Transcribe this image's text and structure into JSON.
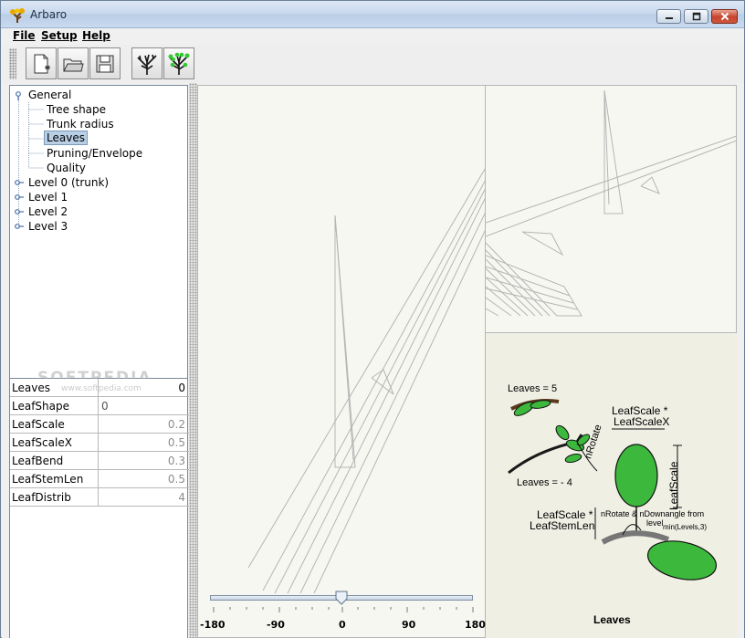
{
  "window": {
    "title": "Arbaro"
  },
  "menu": [
    {
      "label": "File"
    },
    {
      "label": "Setup"
    },
    {
      "label": "Help"
    }
  ],
  "toolbar": {
    "buttons": [
      {
        "icon": "new-file-icon"
      },
      {
        "icon": "open-folder-icon"
      },
      {
        "icon": "save-disk-icon"
      },
      {
        "icon": "tree-render-icon"
      },
      {
        "icon": "tree-leaves-render-icon"
      }
    ]
  },
  "tree": {
    "nodes": [
      {
        "label": "General"
      },
      {
        "label": "Tree shape"
      },
      {
        "label": "Trunk radius"
      },
      {
        "label": "Leaves",
        "selected": true
      },
      {
        "label": "Pruning/Envelope"
      },
      {
        "label": "Quality"
      },
      {
        "label": "Level 0 (trunk)"
      },
      {
        "label": "Level 1"
      },
      {
        "label": "Level 2"
      },
      {
        "label": "Level 3"
      }
    ]
  },
  "params": {
    "rows": [
      {
        "name": "Leaves",
        "value": "0"
      },
      {
        "name": "LeafShape",
        "value": "0"
      },
      {
        "name": "LeafScale",
        "value": "0.2"
      },
      {
        "name": "LeafScaleX",
        "value": "0.5"
      },
      {
        "name": "LeafBend",
        "value": "0.3"
      },
      {
        "name": "LeafStemLen",
        "value": "0.5"
      },
      {
        "name": "LeafDistrib",
        "value": "4"
      }
    ]
  },
  "watermark": {
    "text": "SOFTPEDIA",
    "sub": "www.softpedia.com"
  },
  "slider": {
    "ticks": [
      "-180",
      "-90",
      "0",
      "90",
      "180"
    ],
    "value": 0,
    "min": -180,
    "max": 180
  },
  "help_image": {
    "leaves_eq": "Leaves = 5",
    "leaves_neg": "Leaves = - 4",
    "nrotate": "nRotate",
    "leafscale_x_1": "LeafScale *",
    "leafscale_x_2": "LeafScaleX",
    "leafscale": "LeafScale",
    "stemlen_1": "LeafScale *",
    "stemlen_2": "LeafStemLen",
    "downangle_1": "nRotate & nDownangle from",
    "downangle_2": "level",
    "downangle_3": "min(Levels,3)",
    "caption": "Leaves"
  },
  "colors": {
    "leaf_green": "#3cb83c",
    "selection": "#b8cfe5",
    "view_bg": "#f7f7f2"
  }
}
